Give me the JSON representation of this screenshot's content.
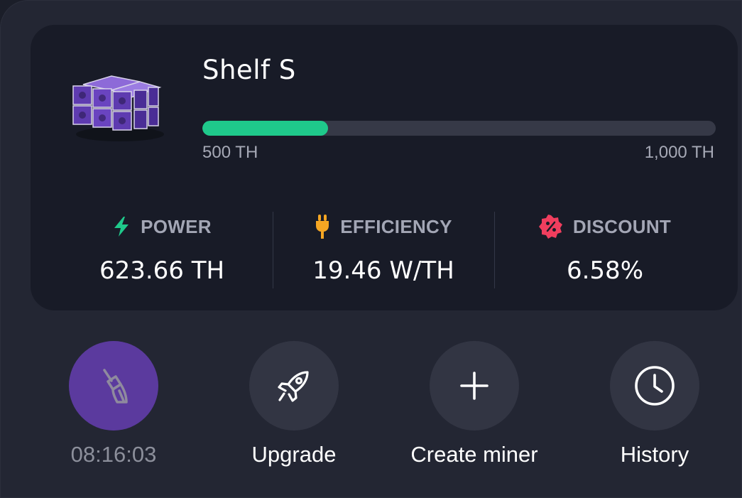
{
  "miner": {
    "name": "Shelf S",
    "progress_fraction": 0.245,
    "range_min": "500 TH",
    "range_max": "1,000 TH"
  },
  "stats": [
    {
      "label": "POWER",
      "value": "623.66 TH",
      "icon": "lightning-icon",
      "color": "#1fc98b"
    },
    {
      "label": "EFFICIENCY",
      "value": "19.46 W/TH",
      "icon": "plug-icon",
      "color": "#f5a623"
    },
    {
      "label": "DISCOUNT",
      "value": "6.58%",
      "icon": "discount-badge-icon",
      "color": "#f03e5e"
    }
  ],
  "actions": [
    {
      "label": "08:16:03",
      "icon": "broom-icon"
    },
    {
      "label": "Upgrade",
      "icon": "rocket-icon"
    },
    {
      "label": "Create miner",
      "icon": "plus-icon"
    },
    {
      "label": "History",
      "icon": "clock-icon"
    }
  ],
  "colors": {
    "accent": "#1fc98b",
    "cleaning_active": "#5b3a9e"
  }
}
